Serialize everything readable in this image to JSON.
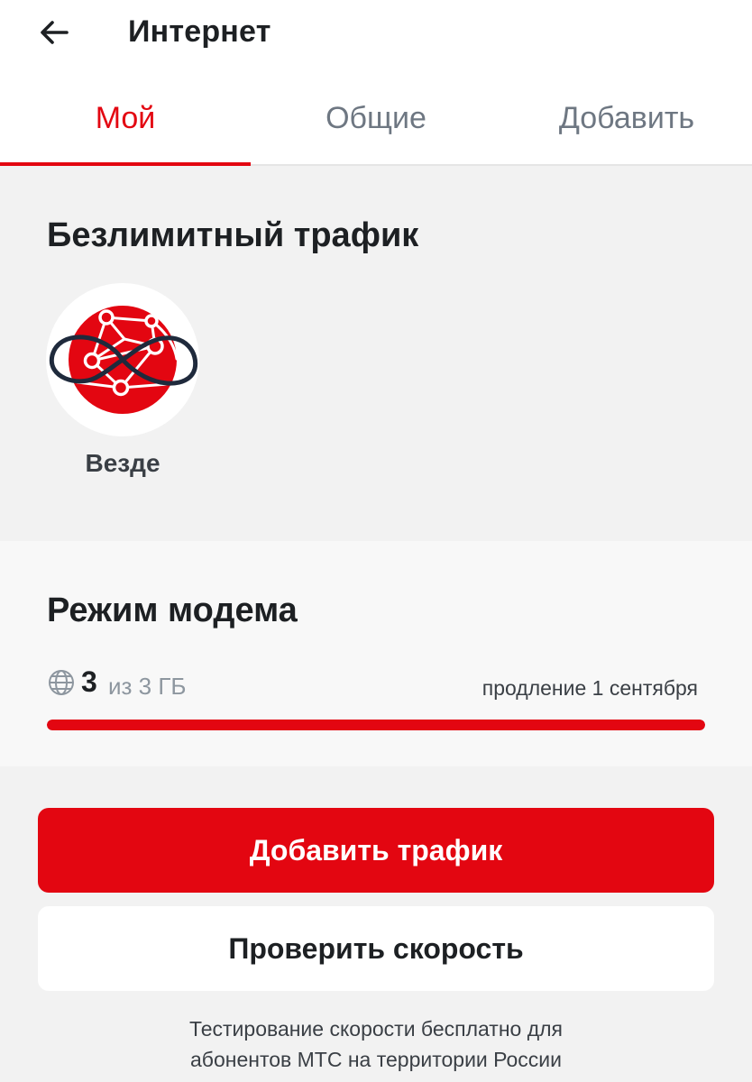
{
  "header": {
    "back_icon": "arrow-left-icon",
    "title": "Интернет"
  },
  "tabs": [
    {
      "label": "Мой",
      "active": true
    },
    {
      "label": "Общие",
      "active": false
    },
    {
      "label": "Добавить",
      "active": false
    }
  ],
  "unlimited": {
    "title": "Безлимитный трафик",
    "options": [
      {
        "label": "Везде",
        "icon": "globe-network-infinity-icon"
      }
    ]
  },
  "modem": {
    "title": "Режим модема",
    "usage_icon": "globe-icon",
    "remaining": "3",
    "total": "из 3 ГБ",
    "renewal": "продление 1 сентября",
    "remaining_fraction": 1.0
  },
  "actions": {
    "add_traffic": "Добавить трафик",
    "check_speed": "Проверить скорость"
  },
  "footnote": {
    "line1": "Тестирование скорости бесплатно для",
    "line2": "абонентов МТС на территории России"
  },
  "colors": {
    "brand_red": "#e30611",
    "tab_inactive": "#6e7782",
    "text_dark": "#1d2023",
    "muted": "#8d969f",
    "infinity_stroke": "#1f2a3c"
  }
}
